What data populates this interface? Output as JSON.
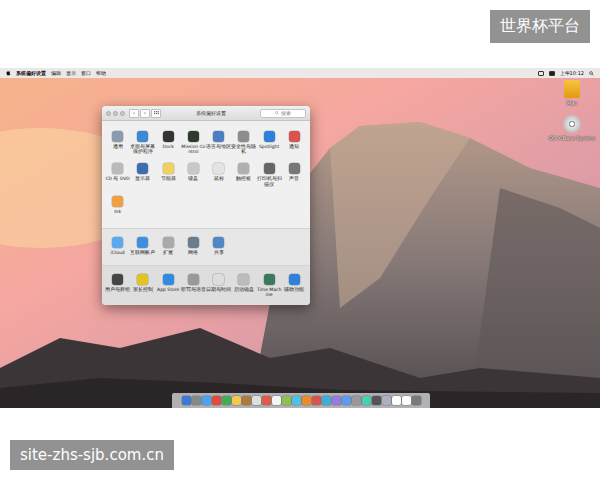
{
  "desktop": {
    "menu_bar": {
      "app": "系统偏好设置",
      "items": [
        "编辑",
        "显示",
        "窗口",
        "帮助"
      ],
      "clock": "上午10:12"
    },
    "icons": [
      {
        "label": "Mac",
        "kind": "drive"
      },
      {
        "label": "OS X Base System",
        "kind": "disc"
      }
    ]
  },
  "window": {
    "title": "系统偏好设置",
    "nav": [
      "‹",
      "›"
    ],
    "search": {
      "placeholder": "搜索"
    },
    "sections": [
      {
        "panes": [
          {
            "label": "通用",
            "color": "#8a9bb0"
          },
          {
            "label": "桌面与屏幕保护程序",
            "color": "#3a8ad8"
          },
          {
            "label": "Dock",
            "color": "#333333"
          },
          {
            "label": "Mission Control",
            "color": "#2d3a2d"
          },
          {
            "label": "语言与地区",
            "color": "#4b7fc2"
          },
          {
            "label": "安全性与隐私",
            "color": "#8d8d8d"
          },
          {
            "label": "Spotlight",
            "color": "#2f7fdc"
          },
          {
            "label": "通知",
            "color": "#d9534f"
          },
          {
            "label": "CD 与 DVD",
            "color": "#bbbbbb"
          },
          {
            "label": "显示器",
            "color": "#3b6fb0"
          },
          {
            "label": "节能器",
            "color": "#f0d060"
          },
          {
            "label": "键盘",
            "color": "#c8c8c8"
          },
          {
            "label": "鼠标",
            "color": "#e4e4e4"
          },
          {
            "label": "触控板",
            "color": "#b0b0b0"
          },
          {
            "label": "打印机与扫描仪",
            "color": "#666666"
          },
          {
            "label": "声音",
            "color": "#777777"
          },
          {
            "label": "Ink",
            "color": "#f0a040"
          }
        ]
      },
      {
        "panes": [
          {
            "label": "iCloud",
            "color": "#5aaaf0"
          },
          {
            "label": "互联网帐户",
            "color": "#3d8fe0"
          },
          {
            "label": "扩展",
            "color": "#aaaaaa"
          },
          {
            "label": "网络",
            "color": "#6b7c8c"
          },
          {
            "label": "共享",
            "color": "#4f87c7"
          }
        ]
      },
      {
        "panes": [
          {
            "label": "用户与群组",
            "color": "#444444"
          },
          {
            "label": "家长控制",
            "color": "#e6c420"
          },
          {
            "label": "App Store",
            "color": "#2f8ae0"
          },
          {
            "label": "听写与语音",
            "color": "#999999"
          },
          {
            "label": "日期与时间",
            "color": "#dddddd"
          },
          {
            "label": "启动磁盘",
            "color": "#bbbbbb"
          },
          {
            "label": "Time Machine",
            "color": "#3a7a5a"
          },
          {
            "label": "辅助功能",
            "color": "#2f7fdc"
          }
        ]
      }
    ]
  },
  "dock": [
    {
      "color": "#3a7bd5"
    },
    {
      "color": "#888888"
    },
    {
      "color": "#4aa3f0"
    },
    {
      "color": "#e04b3a"
    },
    {
      "color": "#3fae5a"
    },
    {
      "color": "#f2c94c"
    },
    {
      "color": "#b07a3a"
    },
    {
      "color": "#e0e0e0"
    },
    {
      "color": "#e25b45"
    },
    {
      "color": "#f5f5f5"
    },
    {
      "color": "#8cc152"
    },
    {
      "color": "#4fc1e9"
    },
    {
      "color": "#f08a24"
    },
    {
      "color": "#d9534f"
    },
    {
      "color": "#3bafda"
    },
    {
      "color": "#967adc"
    },
    {
      "color": "#5d9cec"
    },
    {
      "color": "#999999"
    },
    {
      "color": "#48cfad"
    },
    {
      "color": "#555555"
    },
    {
      "color": "#aab2bd"
    },
    {
      "color": "#ffffff"
    },
    {
      "color": "#ffffff"
    },
    {
      "color": "#7a7a7a"
    }
  ],
  "watermarks": [
    "世界杯平台",
    "site-zhs-sjb.com.cn"
  ]
}
